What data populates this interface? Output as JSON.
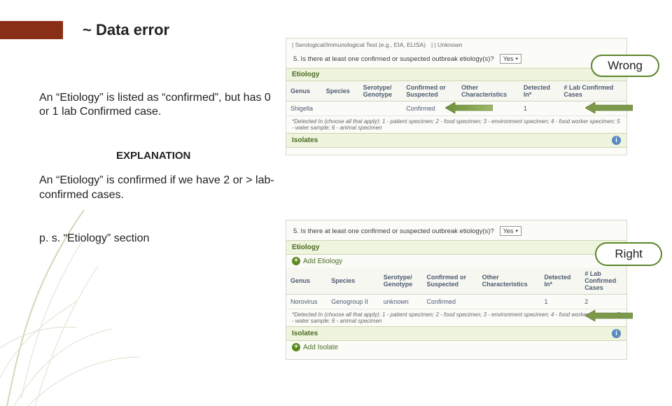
{
  "title": "~ Data error",
  "badges": {
    "wrong": "Wrong",
    "right": "Right"
  },
  "para1": "An “Etiology” is listed as “confirmed”, but has 0 or 1 lab Confirmed case.",
  "explanation_label": "EXPLANATION",
  "para2": "An “Etiology” is confirmed if we have 2 or > lab-confirmed cases.",
  "para3": "p. s. “Etiology” section",
  "shot1": {
    "tiny1": "| Serological/Immunological Test (e.g., EIA, ELISA)",
    "tiny2": "| | Unknown",
    "question": "5. Is there at least one confirmed or suspected outbreak etiology(s)?",
    "select_value": "Yes",
    "section_etiology": "Etiology",
    "section_isolates": "Isolates",
    "footnote": "*Detected In (choose all that apply): 1 - patient specimen; 2 - food specimen; 3 - environment specimen; 4 - food worker specimen; 5 - water sample; 6 - animal specimen",
    "headers": [
      "Genus",
      "Species",
      "Serotype/\nGenotype",
      "Confirmed or\nSuspected",
      "Other\nCharacteristics",
      "Detected\nIn*",
      "# Lab Confirmed\nCases"
    ],
    "row": {
      "genus": "Shigella",
      "species": "",
      "serotype": "",
      "confsusp": "Confirmed",
      "other": "",
      "detected": "1",
      "labcases": ""
    }
  },
  "shot2": {
    "question": "5. Is there at least one confirmed or suspected outbreak etiology(s)?",
    "select_value": "Yes",
    "section_etiology": "Etiology",
    "add_etiology": "Add Etiology",
    "section_isolates": "Isolates",
    "add_isolate": "Add Isolate",
    "footnote": "*Detected In (choose all that apply): 1 - patient specimen; 2 - food specimen; 3 - environment specimen; 4 - food worker specimen; 5 - water sample; 6 - animal specimen",
    "headers": [
      "Genus",
      "Species",
      "Serotype/\nGenotype",
      "Confirmed or\nSuspected",
      "Other\nCharacteristics",
      "Detected\nIn*",
      "# Lab\nConfirmed\nCases"
    ],
    "row": {
      "genus": "Norovirus",
      "species": "Genogroup II",
      "serotype": "unknown",
      "confsusp": "Confirmed",
      "other": "",
      "detected": "1",
      "labcases": "2"
    }
  }
}
